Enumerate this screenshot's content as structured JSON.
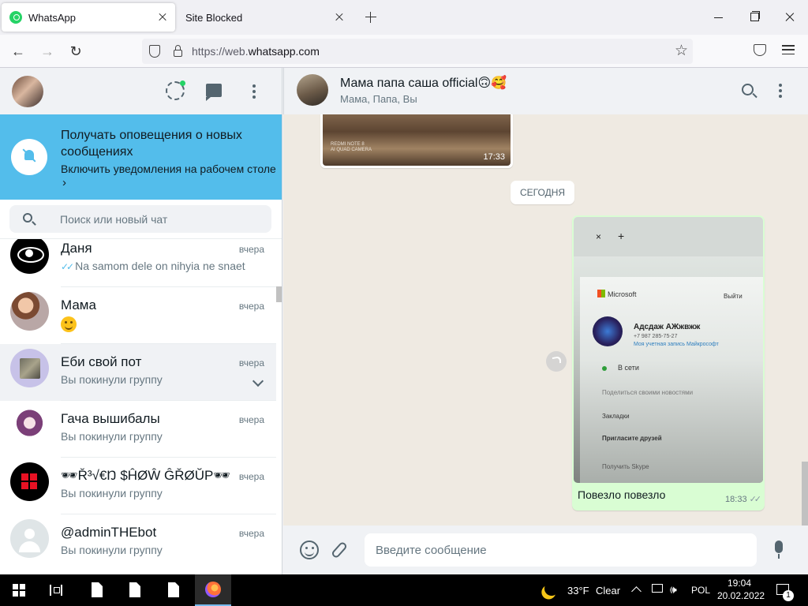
{
  "browser": {
    "tabs": [
      {
        "title": "WhatsApp",
        "active": true
      },
      {
        "title": "Site Blocked",
        "active": false
      }
    ],
    "url_prefix": "https://web.",
    "url_domain": "whatsapp.com",
    "icons": {
      "back": "←",
      "forward": "→",
      "reload": "↻",
      "star": "☆"
    }
  },
  "sidebar": {
    "notification": {
      "title": "Получать оповещения о новых сообщениях",
      "subtitle": "Включить уведомления на рабочем столе",
      "chevron": "›"
    },
    "search_placeholder": "Поиск или новый чат",
    "chats": [
      {
        "name": "Даня",
        "time": "вчера",
        "preview": "Na samom dele on nihyia ne snaet",
        "ticks": "✓✓"
      },
      {
        "name": "Мама",
        "time": "вчера",
        "preview": ""
      },
      {
        "name": "Еби свой пот",
        "time": "вчера",
        "preview": "Вы покинули группу"
      },
      {
        "name": "Гача вышибалы",
        "time": "вчера",
        "preview": "Вы покинули группу"
      },
      {
        "name": "🕶Ř³√€Ŋ $ĤØŴ ĜŘØŬP🕶",
        "time": "вчера",
        "preview": "Вы покинули группу"
      },
      {
        "name": "@adminTHEbot",
        "time": "вчера",
        "preview": "Вы покинули группу"
      }
    ]
  },
  "conversation": {
    "title": "Мама папа саша official🙃🥰",
    "subtitle": "Мама, Папа, Вы",
    "top_message_time": "17:33",
    "top_image_watermark": "REDMI NOTE 8\nAI QUAD CAMERA",
    "date_chip": "СЕГОДНЯ",
    "photo": {
      "tab_close": "×",
      "tab_plus": "+",
      "brand": "Microsoft",
      "signout": "Выйти",
      "account_name": "Адсдаж АЖжвжж",
      "account_phone": "+7 987 285-75-27",
      "account_link": "Моя учетная запись Майкрософт",
      "status": "В сети",
      "rows": [
        "Поделиться своими новостями",
        "Закладки",
        "Пригласите друзей",
        "Получить Skype"
      ]
    },
    "out_message": {
      "caption": "Повезло повезло",
      "time": "18:33",
      "ticks": "✓✓"
    },
    "input_placeholder": "Введите сообщение"
  },
  "taskbar": {
    "weather_temp": "33°F",
    "weather_desc": "Clear",
    "language": "POL",
    "time": "19:04",
    "date": "20.02.2022",
    "volume": "🕪",
    "notifications_count": "1"
  }
}
